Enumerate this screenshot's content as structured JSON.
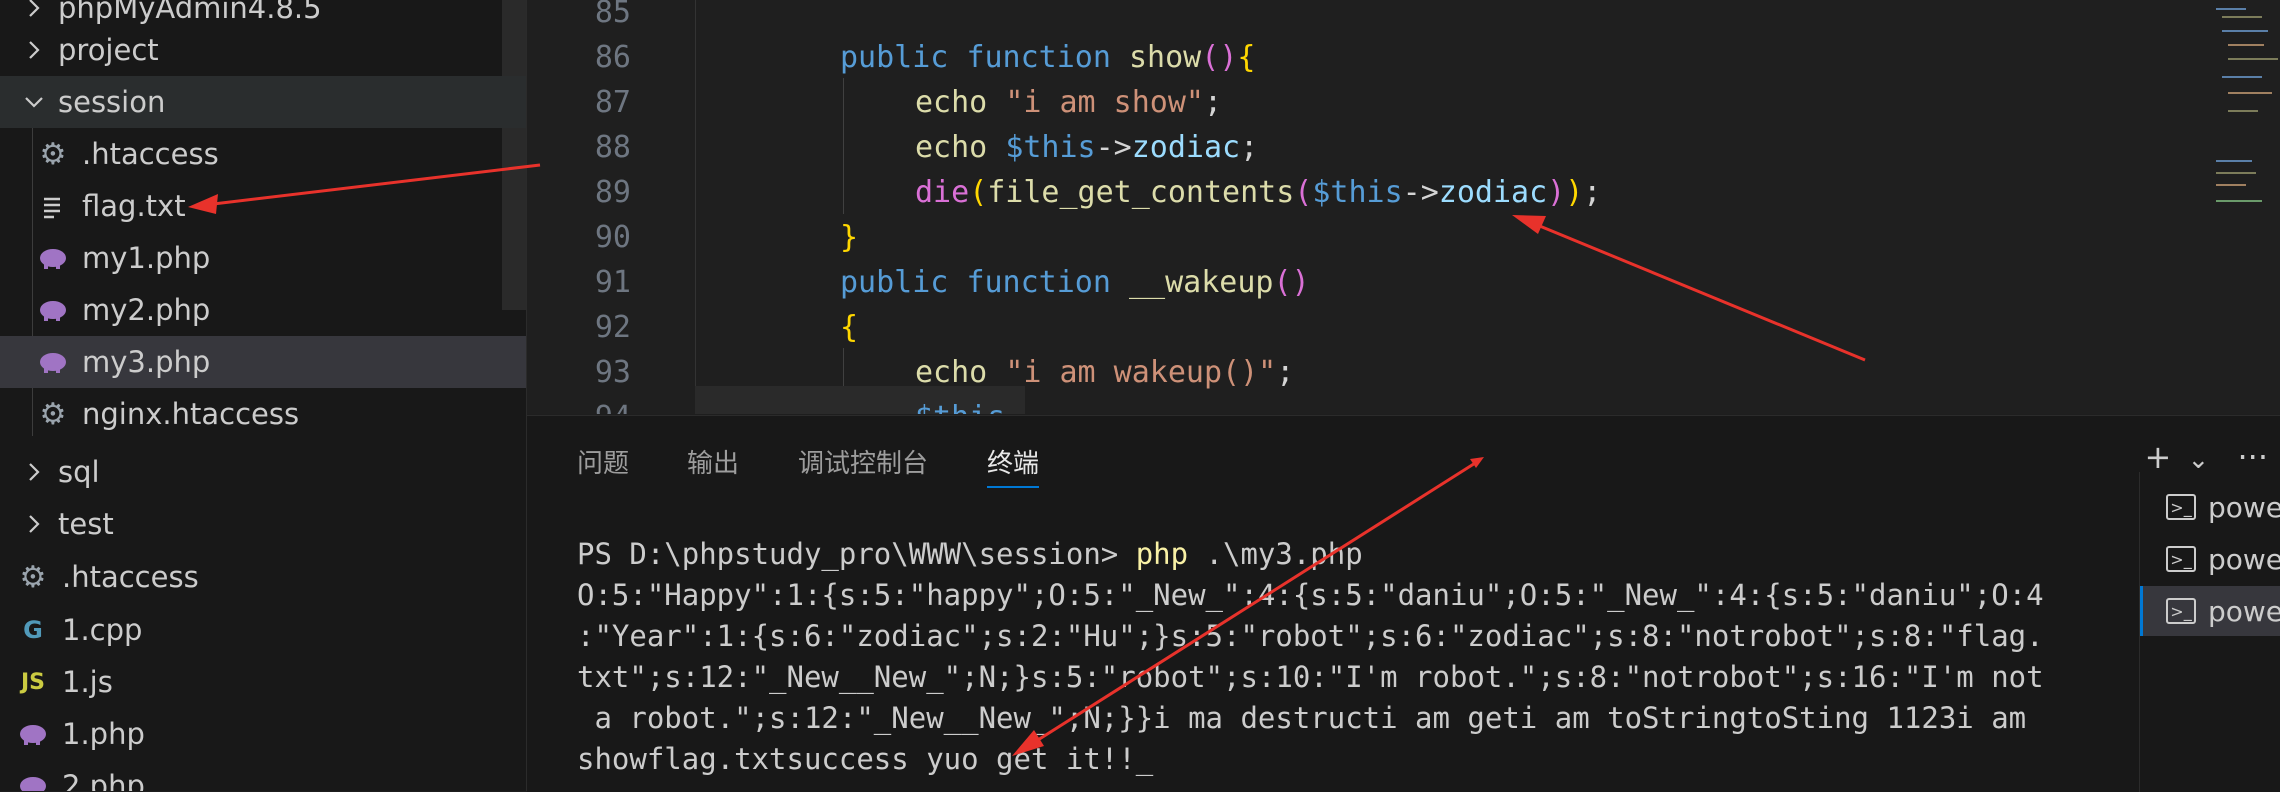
{
  "explorer": {
    "items": [
      {
        "label": "phpMyAdmin4.8.5",
        "kind": "folder-collapsed"
      },
      {
        "label": "project",
        "kind": "folder-collapsed"
      },
      {
        "label": "session",
        "kind": "folder-expanded"
      },
      {
        "label": ".htaccess",
        "kind": "config"
      },
      {
        "label": "flag.txt",
        "kind": "text"
      },
      {
        "label": "my1.php",
        "kind": "php"
      },
      {
        "label": "my2.php",
        "kind": "php"
      },
      {
        "label": "my3.php",
        "kind": "php"
      },
      {
        "label": "nginx.htaccess",
        "kind": "config"
      },
      {
        "label": "sql",
        "kind": "folder-collapsed"
      },
      {
        "label": "test",
        "kind": "folder-collapsed"
      },
      {
        "label": ".htaccess",
        "kind": "config"
      },
      {
        "label": "1.cpp",
        "kind": "cpp"
      },
      {
        "label": "1.js",
        "kind": "js"
      },
      {
        "label": "1.php",
        "kind": "php"
      },
      {
        "label": "2.php",
        "kind": "php"
      }
    ]
  },
  "editor": {
    "line_numbers": [
      "85",
      "86",
      "87",
      "88",
      "89",
      "90",
      "91",
      "92",
      "93",
      "94"
    ],
    "tokens": {
      "public": "public",
      "function": "function",
      "show": "show",
      "wakeup": "__wakeup",
      "echo": "echo",
      "die": "die",
      "file_get_contents": "file_get_contents",
      "this": "$this",
      "arrow": "->",
      "zodiac": "zodiac",
      "str_show": "\"i am show\"",
      "str_wakeup": "\"i am wakeup()\"",
      "semicolon": ";",
      "paren_open": "(",
      "paren_close": ")",
      "brace_open": "{",
      "brace_close": "}"
    }
  },
  "panel": {
    "tabs": [
      "问题",
      "输出",
      "调试控制台",
      "终端"
    ],
    "active_tab": "终端",
    "actions": {
      "add": "+",
      "dropdown": "⌄",
      "more": "···"
    },
    "terminal": {
      "prompt": "PS D:\\phpstudy_pro\\WWW\\session> ",
      "command": "php",
      "args": " .\\my3.php",
      "output_lines": [
        "O:5:\"Happy\":1:{s:5:\"happy\";O:5:\"_New_\":4:{s:5:\"daniu\";O:5:\"_New_\":4:{s:5:\"daniu\";O:4",
        ":\"Year\":1:{s:6:\"zodiac\";s:2:\"Hu\";}s:5:\"robot\";s:6:\"zodiac\";s:8:\"notrobot\";s:8:\"flag.",
        "txt\";s:12:\"_New__New_\";N;}s:5:\"robot\";s:10:\"I'm robot.\";s:8:\"notrobot\";s:16:\"I'm not",
        " a robot.\";s:12:\"_New__New_\";N;}}i ma destructi am geti am toStringtoSting 1123i am",
        "showflag.txtsuccess yuo get it!!"
      ],
      "cursor": "_"
    },
    "terminal_list": [
      "powershell",
      "powershell",
      "powershell"
    ]
  },
  "colors": {
    "annotation_arrow": "#e8322b",
    "accent": "#0078d4"
  }
}
